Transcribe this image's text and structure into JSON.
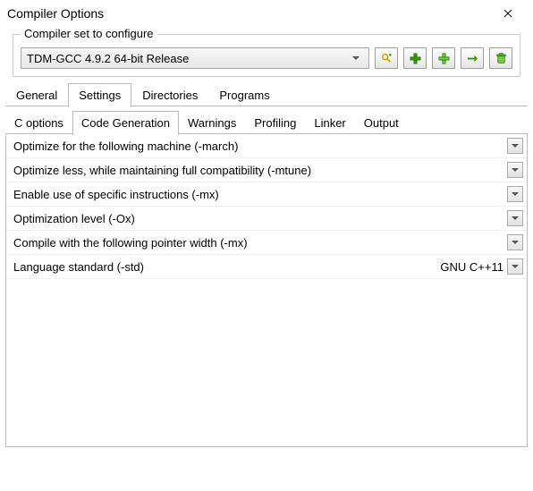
{
  "window": {
    "title": "Compiler Options"
  },
  "groupbox": {
    "legend": "Compiler set to configure",
    "compiler_set": "TDM-GCC 4.9.2 64-bit Release",
    "icons": {
      "find_auto": "find-auto-icon",
      "add_filled": "add-filled-icon",
      "add_blank": "add-blank-icon",
      "rename": "rename-icon",
      "delete": "delete-icon"
    }
  },
  "tabs": {
    "items": [
      {
        "label": "General"
      },
      {
        "label": "Settings"
      },
      {
        "label": "Directories"
      },
      {
        "label": "Programs"
      }
    ],
    "active": 1
  },
  "subtabs": {
    "items": [
      {
        "label": "C options"
      },
      {
        "label": "Code Generation"
      },
      {
        "label": "Warnings"
      },
      {
        "label": "Profiling"
      },
      {
        "label": "Linker"
      },
      {
        "label": "Output"
      }
    ],
    "active": 1
  },
  "options": [
    {
      "label": "Optimize for the following machine (-march)",
      "value": ""
    },
    {
      "label": "Optimize less, while maintaining full compatibility (-mtune)",
      "value": ""
    },
    {
      "label": "Enable use of specific instructions (-mx)",
      "value": ""
    },
    {
      "label": "Optimization level (-Ox)",
      "value": ""
    },
    {
      "label": "Compile with the following pointer width (-mx)",
      "value": ""
    },
    {
      "label": "Language standard (-std)",
      "value": "GNU C++11"
    }
  ]
}
